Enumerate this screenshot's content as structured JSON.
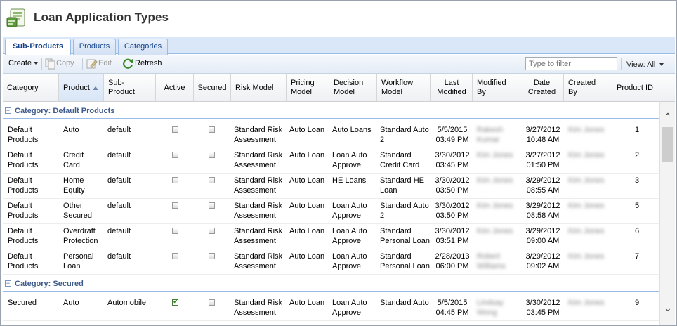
{
  "window": {
    "title": "Loan Application Types",
    "icon": "loan-app-icon"
  },
  "tabs": [
    {
      "label": "Sub-Products",
      "active": true
    },
    {
      "label": "Products",
      "active": false
    },
    {
      "label": "Categories",
      "active": false
    }
  ],
  "toolbar": {
    "create_label": "Create",
    "copy_label": "Copy",
    "edit_label": "Edit",
    "refresh_label": "Refresh",
    "filter_placeholder": "Type to filter",
    "filter_value": "",
    "view_label": "View: All"
  },
  "columns": [
    "Category",
    "Product",
    "Sub-Product",
    "Active",
    "Secured",
    "Risk Model",
    "Pricing Model",
    "Decision Model",
    "Workflow Model",
    "Last Modified",
    "Modified By",
    "Date Created",
    "Created By",
    "Product ID"
  ],
  "sorted_column": "Product",
  "groups": [
    {
      "label": "Category: Default Products",
      "rows": [
        {
          "category": "Default Products",
          "product": "Auto",
          "sub_product": "default",
          "active": false,
          "secured": false,
          "risk_model": "Standard Risk Assessment",
          "pricing_model": "Auto Loan",
          "decision_model": "Auto Loans",
          "workflow_model": "Standard Auto 2",
          "last_modified": "5/5/2015 03:49 PM",
          "modified_by": "Rakesh Kumar",
          "date_created": "3/27/2012 10:48 AM",
          "created_by": "Kim Jones",
          "product_id": "1"
        },
        {
          "category": "Default Products",
          "product": "Credit Card",
          "sub_product": "default",
          "active": false,
          "secured": false,
          "risk_model": "Standard Risk Assessment",
          "pricing_model": "Auto Loan",
          "decision_model": "Loan Auto Approve",
          "workflow_model": "Standard Credit Card",
          "last_modified": "3/30/2012 03:45 PM",
          "modified_by": "Kim Jones",
          "date_created": "3/27/2012 01:50 PM",
          "created_by": "Kim Jones",
          "product_id": "2"
        },
        {
          "category": "Default Products",
          "product": "Home Equity",
          "sub_product": "default",
          "active": false,
          "secured": false,
          "risk_model": "Standard Risk Assessment",
          "pricing_model": "Auto Loan",
          "decision_model": "HE Loans",
          "workflow_model": "Standard HE Loan",
          "last_modified": "3/30/2012 03:50 PM",
          "modified_by": "Kim Jones",
          "date_created": "3/29/2012 08:55 AM",
          "created_by": "Kim Jones",
          "product_id": "3"
        },
        {
          "category": "Default Products",
          "product": "Other Secured",
          "sub_product": "default",
          "active": false,
          "secured": false,
          "risk_model": "Standard Risk Assessment",
          "pricing_model": "Auto Loan",
          "decision_model": "Loan Auto Approve",
          "workflow_model": "Standard Auto 2",
          "last_modified": "3/30/2012 03:50 PM",
          "modified_by": "Kim Jones",
          "date_created": "3/29/2012 08:58 AM",
          "created_by": "Kim Jones",
          "product_id": "5"
        },
        {
          "category": "Default Products",
          "product": "Overdraft Protection",
          "sub_product": "default",
          "active": false,
          "secured": false,
          "risk_model": "Standard Risk Assessment",
          "pricing_model": "Auto Loan",
          "decision_model": "Loan Auto Approve",
          "workflow_model": "Standard Personal Loan",
          "last_modified": "3/30/2012 03:51 PM",
          "modified_by": "Kim Jones",
          "date_created": "3/29/2012 09:00 AM",
          "created_by": "Kim Jones",
          "product_id": "6"
        },
        {
          "category": "Default Products",
          "product": "Personal Loan",
          "sub_product": "default",
          "active": false,
          "secured": false,
          "risk_model": "Standard Risk Assessment",
          "pricing_model": "Auto Loan",
          "decision_model": "Loan Auto Approve",
          "workflow_model": "Standard Personal Loan",
          "last_modified": "2/28/2013 06:00 PM",
          "modified_by": "Robert Williams",
          "date_created": "3/29/2012 09:02 AM",
          "created_by": "Kim Jones",
          "product_id": "7"
        }
      ]
    },
    {
      "label": "Category: Secured",
      "rows": [
        {
          "category": "Secured",
          "product": "Auto",
          "sub_product": "Automobile",
          "active": true,
          "secured": false,
          "risk_model": "Standard Risk Assessment",
          "pricing_model": "Auto Loan",
          "decision_model": "Loan Auto Approve",
          "workflow_model": "Standard Auto",
          "last_modified": "5/5/2015 04:45 PM",
          "modified_by": "Lindsay Wong",
          "date_created": "3/30/2012 03:45 PM",
          "created_by": "Kim Jones",
          "product_id": "9"
        }
      ]
    }
  ],
  "colors": {
    "accent": "#15428b",
    "group_text": "#3d5a8a",
    "tab_strip": "#d9e7f8"
  }
}
